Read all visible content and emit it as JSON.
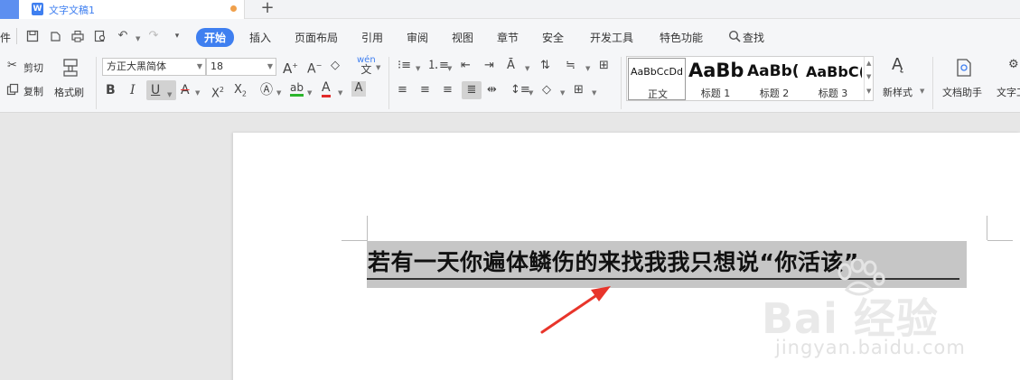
{
  "tabbar": {
    "doc_title": "文字文稿1",
    "doc_icon": "W",
    "new_tab": "+"
  },
  "menubar": {
    "file_partial": "件",
    "items": [
      "开始",
      "插入",
      "页面布局",
      "引用",
      "审阅",
      "视图",
      "章节",
      "安全",
      "开发工具",
      "特色功能"
    ],
    "search": "查找"
  },
  "ribbon": {
    "cut": "剪切",
    "copy": "复制",
    "format_painter": "格式刷",
    "font_name": "方正大黑简体",
    "font_size": "18",
    "styles": [
      {
        "preview": "AaBbCcDd",
        "name": "正文"
      },
      {
        "preview": "AaBb",
        "name": "标题 1"
      },
      {
        "preview": "AaBb(",
        "name": "标题 2"
      },
      {
        "preview": "AaBbC(",
        "name": "标题 3"
      }
    ],
    "new_style": "新样式",
    "doc_assistant": "文档助手",
    "text_tools_partial": "文字工"
  },
  "document": {
    "heading": "若有一天你遍体鳞伤的来找我我只想说“你活该”"
  },
  "watermark": {
    "main": "Bai 经验",
    "sub": "jingyan.baidu.com"
  },
  "colors": {
    "accent": "#3f7ff0",
    "selection": "#c6c6c6",
    "annotation_arrow": "#e8352b",
    "unsaved_dot": "#f0a04b"
  }
}
